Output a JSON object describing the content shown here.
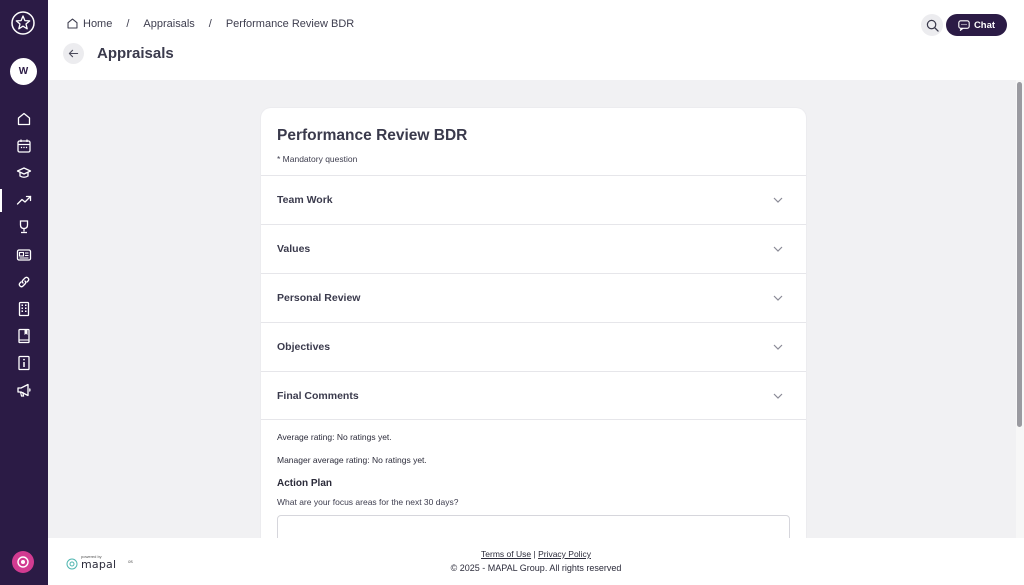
{
  "breadcrumb": {
    "home": "Home",
    "separator": "/",
    "appraisals": "Appraisals",
    "current": "Performance Review BDR"
  },
  "header": {
    "title": "Appraisals",
    "chat_label": "Chat"
  },
  "sidebar": {
    "avatar_initial": "W",
    "items": [
      {
        "icon": "home-icon"
      },
      {
        "icon": "calendar-icon"
      },
      {
        "icon": "graduation-cap-icon"
      },
      {
        "icon": "trend-up-icon",
        "active": true
      },
      {
        "icon": "trophy-icon"
      },
      {
        "icon": "id-card-icon"
      },
      {
        "icon": "link-icon"
      },
      {
        "icon": "building-icon"
      },
      {
        "icon": "book-icon"
      },
      {
        "icon": "info-icon"
      },
      {
        "icon": "megaphone-icon"
      }
    ]
  },
  "form": {
    "title": "Performance Review BDR",
    "mandatory_note": "* Mandatory question",
    "sections": [
      "Team Work",
      "Values",
      "Personal Review",
      "Objectives",
      "Final Comments"
    ],
    "average_rating": "Average rating: No ratings yet.",
    "manager_average_rating": "Manager average rating: No ratings yet.",
    "action_plan_title": "Action Plan",
    "action_plan_question": "What are your focus areas for the next 30 days?",
    "action_plan_value": ""
  },
  "footer": {
    "powered_by": "powered by",
    "brand": "mapal",
    "brand_suffix": "os",
    "terms": "Terms of Use",
    "links_separator": "|",
    "privacy": "Privacy Policy",
    "copyright": "© 2025 - MAPAL Group. All rights reserved"
  },
  "colors": {
    "sidebar": "#2b1b45",
    "accent_button": "#2b1b45",
    "page_bg": "#f1f1f3",
    "bottom_icon": "#d23b91"
  }
}
